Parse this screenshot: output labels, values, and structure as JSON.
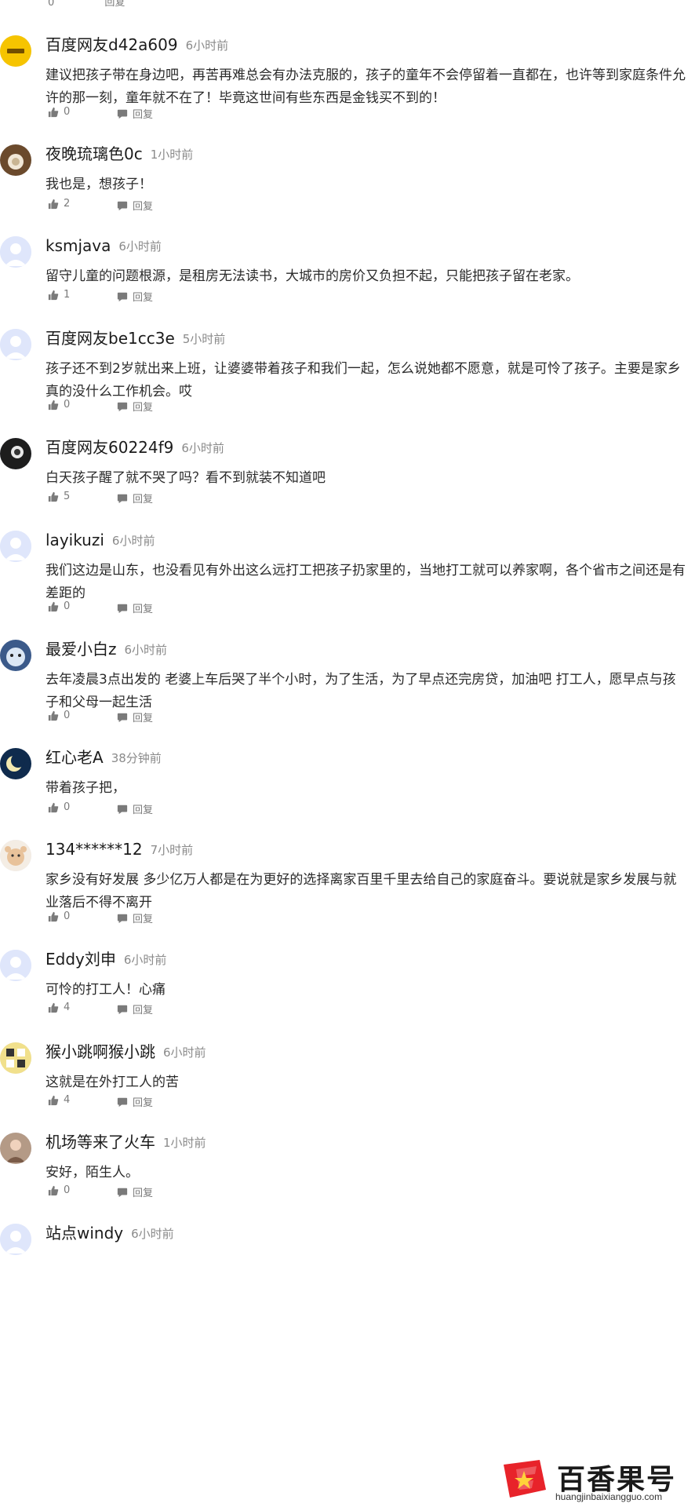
{
  "top_partial": {
    "likes": "0",
    "reply_label": "回复"
  },
  "comments": [
    {
      "user": "百度网友d42a609",
      "time": "6小时前",
      "text": "建议把孩子带在身边吧，再苦再难总会有办法克服的，孩子的童年不会停留着一直都在，也许等到家庭条件允许的那一刻，童年就不在了！毕竟这世间有些东西是金钱买不到的！",
      "likes": "0",
      "reply": "回复",
      "avatar": "yellow-logo"
    },
    {
      "user": "夜晚琉璃色0c",
      "time": "1小时前",
      "text": "我也是，想孩子！",
      "likes": "2",
      "reply": "回复",
      "avatar": "brown-photo"
    },
    {
      "user": "ksmjava",
      "time": "6小时前",
      "text": "留守儿童的问题根源，是租房无法读书，大城市的房价又负担不起，只能把孩子留在老家。",
      "likes": "1",
      "reply": "回复",
      "avatar": "default"
    },
    {
      "user": "百度网友be1cc3e",
      "time": "5小时前",
      "text": "孩子还不到2岁就出来上班，让婆婆带着孩子和我们一起，怎么说她都不愿意，就是可怜了孩子。主要是家乡真的没什么工作机会。哎",
      "likes": "0",
      "reply": "回复",
      "avatar": "default"
    },
    {
      "user": "百度网友60224f9",
      "time": "6小时前",
      "text": "白天孩子醒了就不哭了吗？看不到就装不知道吧",
      "likes": "5",
      "reply": "回复",
      "avatar": "dark-photo"
    },
    {
      "user": "layikuzi",
      "time": "6小时前",
      "text": "我们这边是山东，也没看见有外出这么远打工把孩子扔家里的，当地打工就可以养家啊，各个省市之间还是有差距的",
      "likes": "0",
      "reply": "回复",
      "avatar": "default"
    },
    {
      "user": "最爱小白z",
      "time": "6小时前",
      "text": "去年凌晨3点出发的 老婆上车后哭了半个小时，为了生活，为了早点还完房贷，加油吧 打工人，愿早点与孩子和父母一起生活",
      "likes": "0",
      "reply": "回复",
      "avatar": "cartoon-blue"
    },
    {
      "user": "红心老A",
      "time": "38分钟前",
      "text": "带着孩子把，",
      "likes": "0",
      "reply": "回复",
      "avatar": "moon-night"
    },
    {
      "user": "134******12",
      "time": "7小时前",
      "text": "家乡没有好发展 多少亿万人都是在为更好的选择离家百里千里去给自己的家庭奋斗。要说就是家乡发展与就业落后不得不离开",
      "likes": "0",
      "reply": "回复",
      "avatar": "cartoon-pink"
    },
    {
      "user": "Eddy刘申",
      "time": "6小时前",
      "text": "可怜的打工人！心痛",
      "likes": "4",
      "reply": "回复",
      "avatar": "default"
    },
    {
      "user": "猴小跳啊猴小跳",
      "time": "6小时前",
      "text": "这就是在外打工人的苦",
      "likes": "4",
      "reply": "回复",
      "avatar": "yellow-grid"
    },
    {
      "user": "机场等来了火车",
      "time": "1小时前",
      "text": "安好，陌生人。",
      "likes": "0",
      "reply": "回复",
      "avatar": "person-photo"
    },
    {
      "user": "站点windy",
      "time": "6小时前",
      "text": "",
      "likes": "",
      "reply": "",
      "avatar": "default"
    }
  ],
  "watermark": {
    "title": "百香果号",
    "url": "huangjinbaixiangguo.com"
  },
  "colors": {
    "default_avatar_bg": "#dfe6fb",
    "default_avatar_fg": "#ffffff",
    "watermark_red": "#e8232a"
  }
}
